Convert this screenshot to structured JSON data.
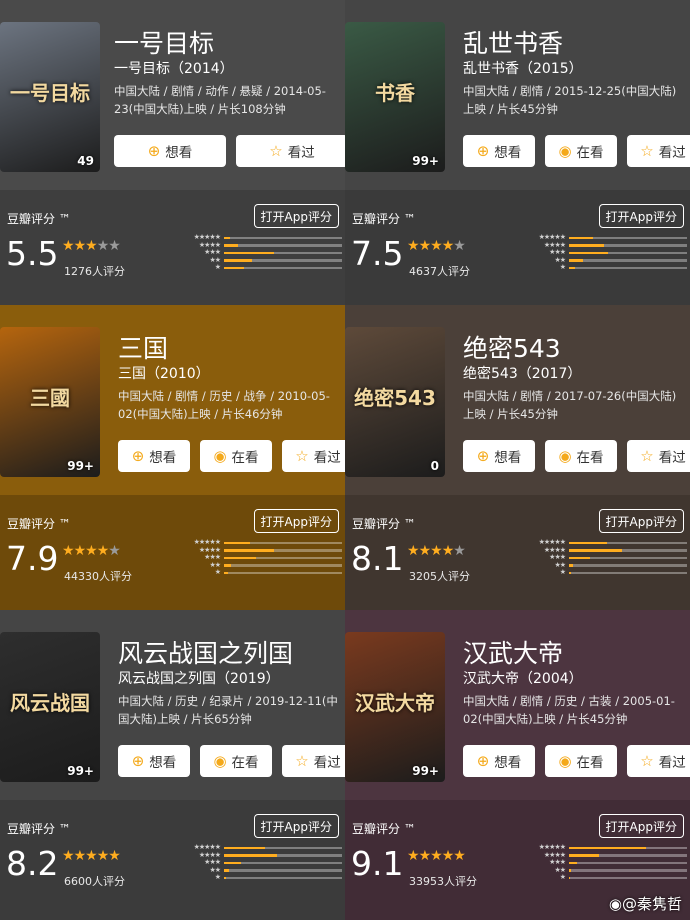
{
  "buttons": {
    "want": "想看",
    "doing": "在看",
    "seen": "看过"
  },
  "rating_label": "豆瓣评分 ™",
  "app_button": "打开App评分",
  "star_labels": [
    "★★★★★",
    "★★★★",
    "★★★",
    "★★",
    "★"
  ],
  "watermark": "@秦隽哲",
  "colors": {
    "star": "#ffad1f",
    "button_icon": "#f4a91a"
  },
  "movies": [
    {
      "title": "一号目标",
      "subtitle": "一号目标（2014）",
      "meta": "中国大陆 / 剧情 / 动作 / 悬疑 / 2014-05-23(中国大陆)上映 / 片长108分钟",
      "poster_badge": "49",
      "poster_text": "一号目标",
      "score": "5.5",
      "stars": 3,
      "count": "1276人评分",
      "dist": [
        0.05,
        0.12,
        0.42,
        0.24,
        0.17
      ],
      "colors": {
        "top": "#4a4a4a",
        "bottom": "#3e3e3e",
        "poster": "#6c7480"
      }
    },
    {
      "title": "乱世书香",
      "subtitle": "乱世书香（2015）",
      "meta": "中国大陆 / 剧情 / 2015-12-25(中国大陆)上映 / 片长45分钟",
      "poster_badge": "99+",
      "poster_text": "书香",
      "score": "7.5",
      "stars": 4,
      "count": "4637人评分",
      "dist": [
        0.2,
        0.3,
        0.33,
        0.12,
        0.05
      ],
      "colors": {
        "top": "#454545",
        "bottom": "#3a3a3a",
        "poster": "#3a5a45"
      }
    },
    {
      "title": "三国",
      "subtitle": "三国（2010）",
      "meta": "中国大陆 / 剧情 / 历史 / 战争 / 2010-05-02(中国大陆)上映 / 片长46分钟",
      "poster_badge": "99+",
      "poster_text": "三國",
      "score": "7.9",
      "stars": 4,
      "count": "44330人评分",
      "dist": [
        0.22,
        0.42,
        0.27,
        0.06,
        0.03
      ],
      "colors": {
        "top": "#8a5d0c",
        "bottom": "#6e4a0a",
        "poster": "#b5650e"
      }
    },
    {
      "title": "绝密543",
      "subtitle": "绝密543（2017）",
      "meta": "中国大陆 / 剧情 / 2017-07-26(中国大陆)上映 / 片长45分钟",
      "poster_badge": "0",
      "poster_text": "绝密543",
      "score": "8.1",
      "stars": 4,
      "count": "3205人评分",
      "dist": [
        0.32,
        0.45,
        0.18,
        0.03,
        0.02
      ],
      "colors": {
        "top": "#4b4039",
        "bottom": "#40362f",
        "poster": "#5e4a3a"
      }
    },
    {
      "title": "风云战国之列国",
      "subtitle": "风云战国之列国（2019）",
      "meta": "中国大陆 / 历史 / 纪录片 / 2019-12-11(中国大陆)上映 / 片长65分钟",
      "poster_badge": "99+",
      "poster_text": "风云战国",
      "score": "8.2",
      "stars": 4.5,
      "count": "6600人评分",
      "dist": [
        0.35,
        0.45,
        0.14,
        0.04,
        0.02
      ],
      "colors": {
        "top": "#454545",
        "bottom": "#3b3b3b",
        "poster": "#2e2e2e"
      }
    },
    {
      "title": "汉武大帝",
      "subtitle": "汉武大帝（2004）",
      "meta": "中国大陆 / 剧情 / 历史 / 古装 / 2005-01-02(中国大陆)上映 / 片长45分钟",
      "poster_badge": "99+",
      "poster_text": "汉武大帝",
      "score": "9.1",
      "stars": 4.5,
      "count": "33953人评分",
      "dist": [
        0.65,
        0.25,
        0.07,
        0.02,
        0.01
      ],
      "colors": {
        "top": "#4d3540",
        "bottom": "#412c36",
        "poster": "#7a3a1e"
      }
    }
  ]
}
